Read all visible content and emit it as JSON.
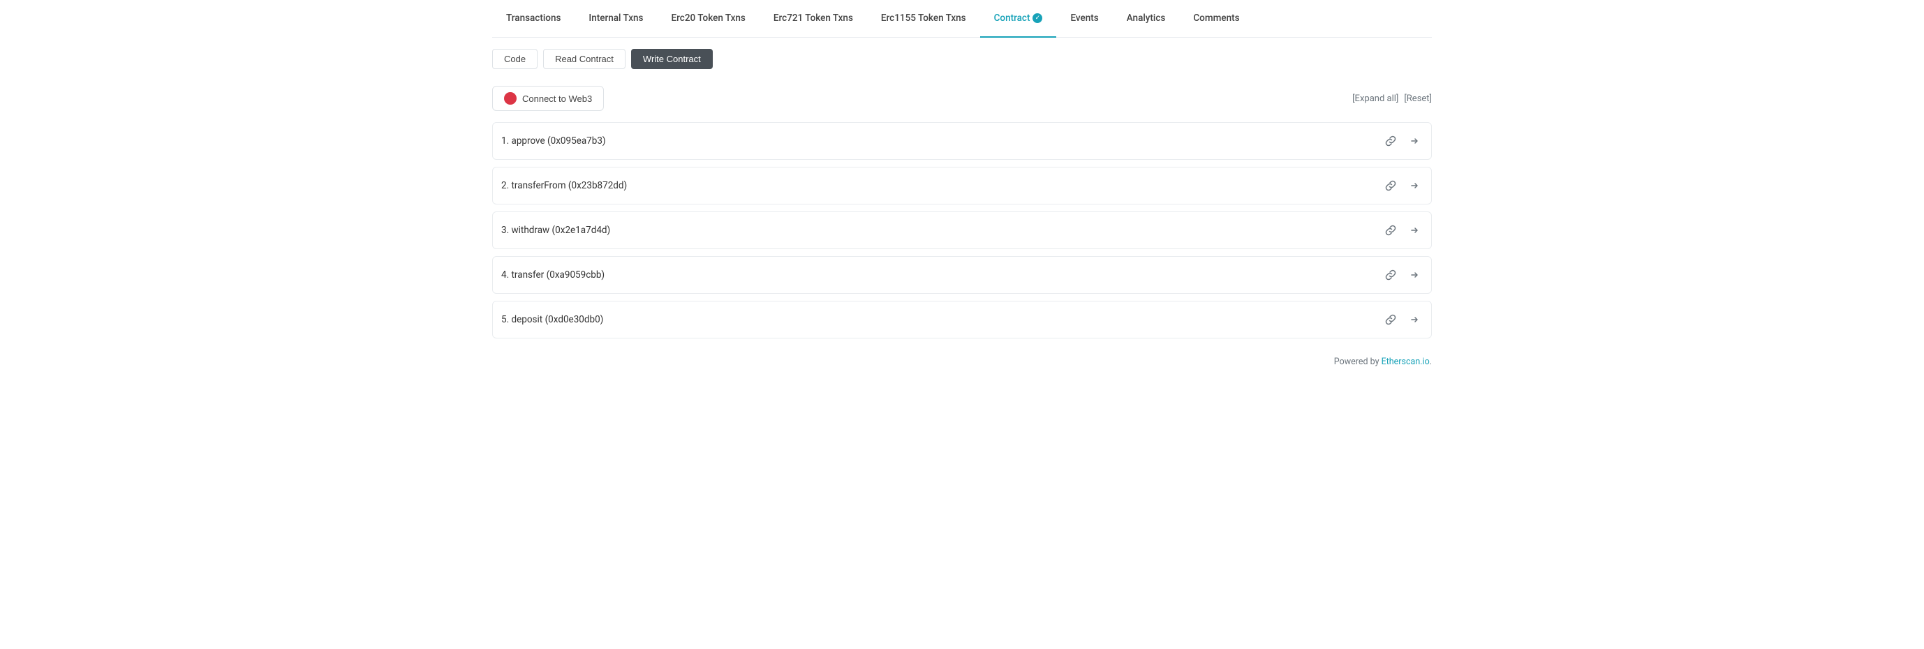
{
  "tabs": [
    {
      "id": "transactions",
      "label": "Transactions",
      "active": false
    },
    {
      "id": "internal-txns",
      "label": "Internal Txns",
      "active": false
    },
    {
      "id": "erc20-token-txns",
      "label": "Erc20 Token Txns",
      "active": false
    },
    {
      "id": "erc721-token-txns",
      "label": "Erc721 Token Txns",
      "active": false
    },
    {
      "id": "erc1155-token-txns",
      "label": "Erc1155 Token Txns",
      "active": false
    },
    {
      "id": "contract",
      "label": "Contract",
      "active": true,
      "verified": true
    },
    {
      "id": "events",
      "label": "Events",
      "active": false
    },
    {
      "id": "analytics",
      "label": "Analytics",
      "active": false
    },
    {
      "id": "comments",
      "label": "Comments",
      "active": false
    }
  ],
  "subButtons": [
    {
      "id": "code",
      "label": "Code",
      "active": false
    },
    {
      "id": "read-contract",
      "label": "Read Contract",
      "active": false
    },
    {
      "id": "write-contract",
      "label": "Write Contract",
      "active": true
    }
  ],
  "connectButton": {
    "label": "Connect to Web3"
  },
  "actionLinks": {
    "expandAll": "[Expand all]",
    "reset": "[Reset]"
  },
  "contractItems": [
    {
      "id": 1,
      "label": "1. approve (0x095ea7b3)"
    },
    {
      "id": 2,
      "label": "2. transferFrom (0x23b872dd)"
    },
    {
      "id": 3,
      "label": "3. withdraw (0x2e1a7d4d)"
    },
    {
      "id": 4,
      "label": "4. transfer (0xa9059cbb)"
    },
    {
      "id": 5,
      "label": "5. deposit (0xd0e30db0)"
    }
  ],
  "footer": {
    "poweredBy": "Powered by ",
    "linkText": "Etherscan.io",
    "linkSuffix": "."
  }
}
